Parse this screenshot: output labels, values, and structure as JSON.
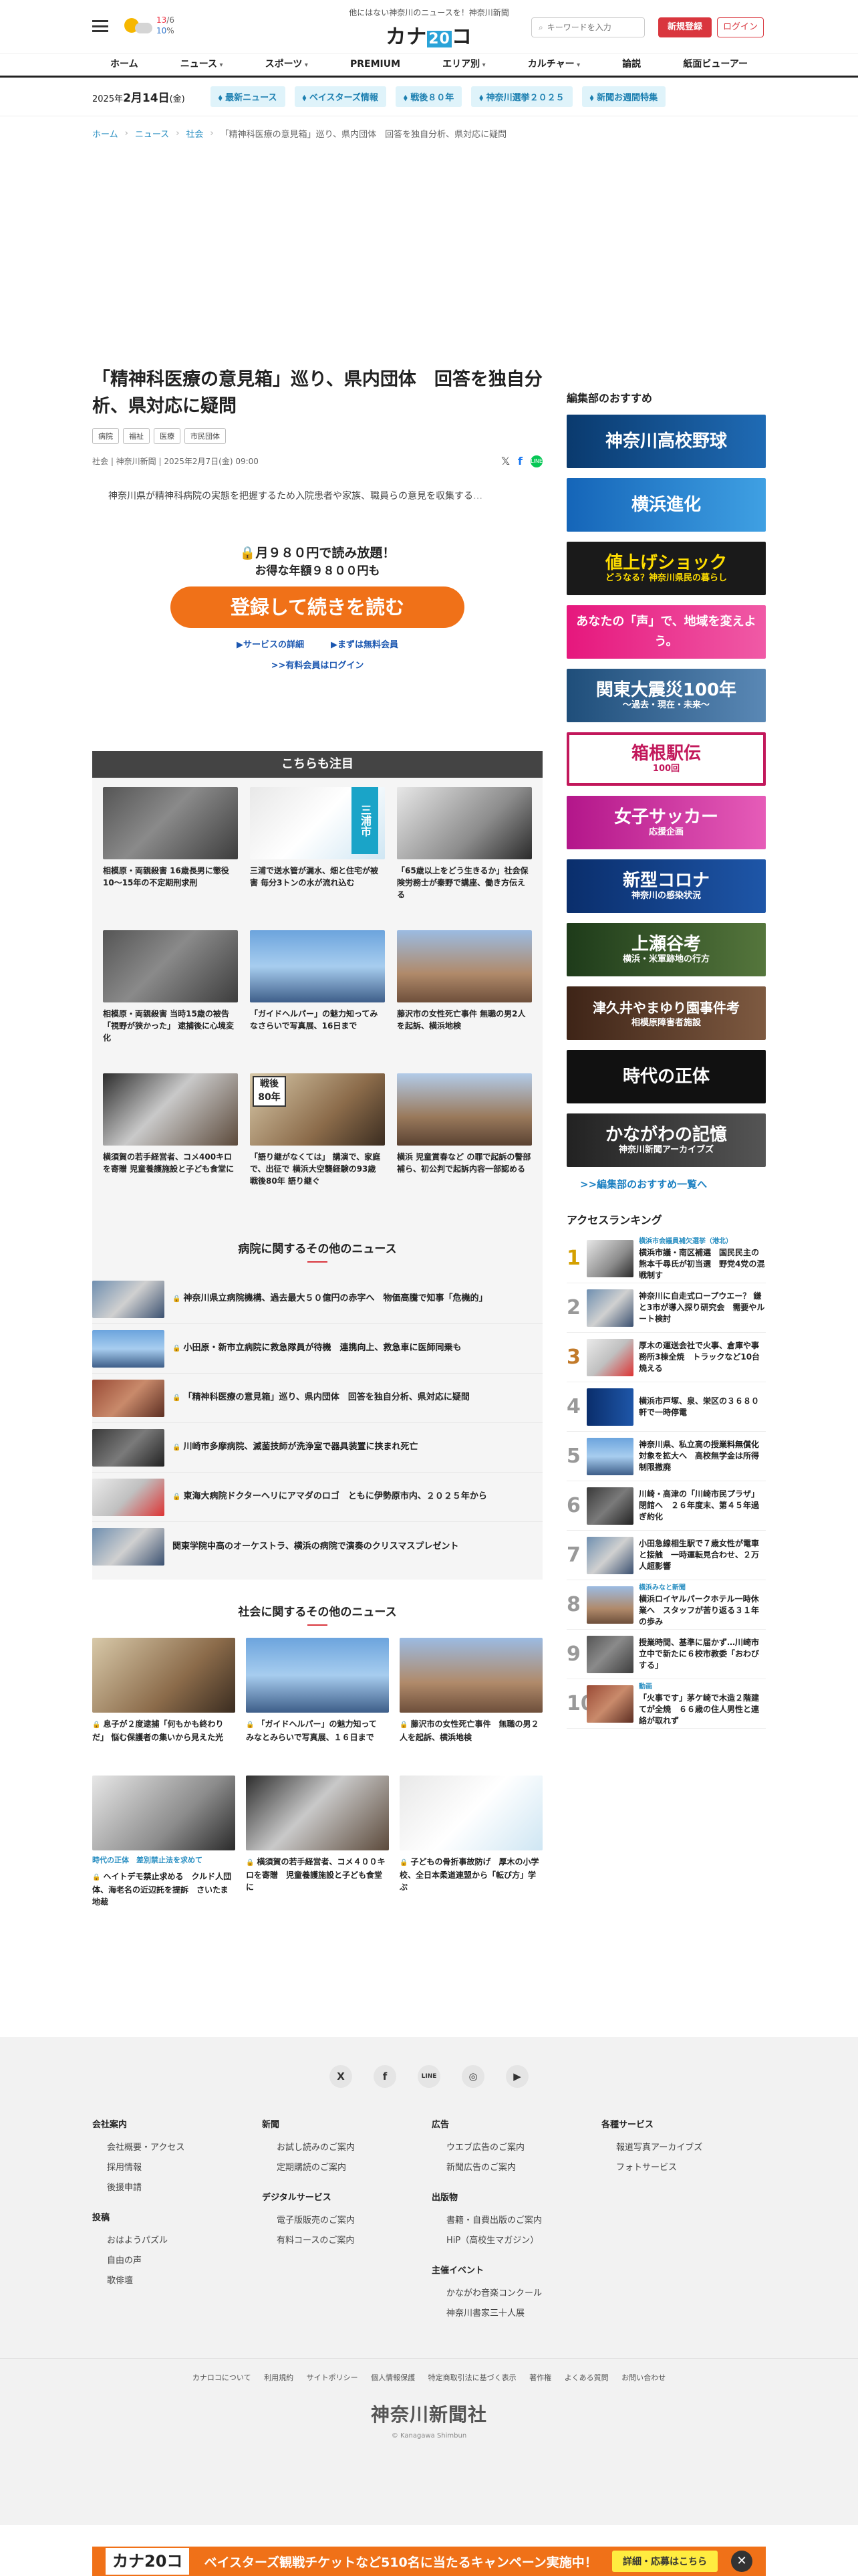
{
  "header": {
    "tagline": "他にはない神奈川のニュースを！神奈川新聞",
    "logo_pre": "カナ",
    "logo_num": "20",
    "logo_post": "コ",
    "weather_hi": "13",
    "weather_lo": "10",
    "weather_hi_unit": "/6",
    "weather_lo_unit": "%",
    "search_placeholder": "キーワードを入力",
    "register": "新規登録",
    "login": "ログイン"
  },
  "nav": [
    "ホーム",
    "ニュース",
    "スポーツ",
    "PREMIUM",
    "エリア別",
    "カルチャー",
    "論説",
    "紙面ビューアー"
  ],
  "datebar": {
    "date_pre": "2025年",
    "date_main": "2月14日",
    "date_post": "(金)",
    "chips": [
      "最新ニュース",
      "ベイスターズ情報",
      "戦後８０年",
      "神奈川選挙２０２５",
      "新聞お週間特集"
    ]
  },
  "breadcrumb": [
    "ホーム",
    "ニュース",
    "社会",
    "「精神科医療の意見箱」巡り、県内団体　回答を独自分析、県対応に疑問"
  ],
  "article": {
    "title": "「精神科医療の意見箱」巡り、県内団体　回答を独自分析、県対応に疑問",
    "tags": [
      "病院",
      "福祉",
      "医療",
      "市民団体"
    ],
    "meta": "社会 | 神奈川新聞 | 2025年2月7日(金) 09:00",
    "lede": "　神奈川県が精神科病院の実態を把握するため入院患者や家族、職員らの意見を収集する",
    "lede_fade": "…"
  },
  "paywall": {
    "line1": "🔒月９８０円で読み放題！",
    "line2": "お得な年額９８００円も",
    "cta": "登録して続きを読む",
    "link1": "▶サービスの詳細",
    "link2": "▶まずは無料会員",
    "link3": ">>有料会員はログイン"
  },
  "related": {
    "heading": "こちらも注目",
    "items": [
      {
        "title": "相模原・両親殺害 16歳長男に懲役10〜15年の不定期刑求刑",
        "label": ""
      },
      {
        "title": "三浦で送水管が漏水、畑と住宅が被害 毎分3トンの水が流れ込む",
        "label": "三浦市"
      },
      {
        "title": "「65歳以上をどう生きるか」社会保険労務士が秦野で講座、働き方伝える",
        "label": ""
      },
      {
        "title": "相模原・両親殺害 当時15歳の被告「視野が狭かった」 逮捕後に心境変化",
        "label": ""
      },
      {
        "title": "「ガイドヘルパー」の魅力知ってみなさらいで写真展、16日まで",
        "label": ""
      },
      {
        "title": "藤沢市の女性死亡事件 無職の男2人を起訴、横浜地検",
        "label": ""
      },
      {
        "title": "横須賀の若手経営者、コメ400キロを寄贈 児童養護施設と子ども食堂に",
        "label": ""
      },
      {
        "title": "「語り継がなくては」 講演で、家庭で、出征で 横浜大空襲経験の93歳 戦後80年 語り継ぐ",
        "label": "戦後80年"
      },
      {
        "title": "横浜 児童賞春など の罪で起訴の警部補ら、初公判で起訴内容一部認める",
        "label": ""
      }
    ]
  },
  "hospital": {
    "heading": "病院に関するその他のニュース",
    "items": [
      "神奈川県立病院機構、過去最大５０億円の赤字へ　物価高騰で知事「危機的」",
      "小田原・新市立病院に救急隊員が待機　連携向上、救急車に医師同乗も",
      "「精神科医療の意見箱」巡り、県内団体　回答を独自分析、県対応に疑問",
      "川崎市多摩病院、滅菌技師が洗浄室で器具装置に挟まれ死亡",
      "東海大病院ドクターヘリにアマダのロゴ　ともに伊勢原市内、２０２５年から",
      "関東学院中高のオーケストラ、横浜の病院で演奏のクリスマスプレゼント"
    ]
  },
  "society": {
    "heading": "社会に関するその他のニュース",
    "items": [
      {
        "cat": "",
        "title": "息子が２度逮捕「何もかも終わりだ」 悩む保護者の集いから見えた光"
      },
      {
        "cat": "",
        "title": "「ガイドヘルパー」の魅力知って　みなとみらいで写真展、１６日まで"
      },
      {
        "cat": "",
        "title": "藤沢市の女性死亡事件　無職の男２人を起訴、横浜地検"
      },
      {
        "cat": "時代の正体　差別禁止法を求めて",
        "title": "ヘイトデモ禁止求める　クルド人団体、海老名の近辺託を提訴　さいたま地裁"
      },
      {
        "cat": "",
        "title": "横須賀の若手経営者、コメ４００キロを寄贈　児童養護施設と子ども食堂に"
      },
      {
        "cat": "",
        "title": "子どもの骨折事故防げ　厚木の小学校、全日本柔道連盟から「転び方」学ぶ"
      }
    ]
  },
  "sidebar": {
    "heading": "編集部のおすすめ",
    "banners": [
      {
        "text": "神奈川高校野球",
        "sub": ""
      },
      {
        "text": "横浜進化",
        "sub": ""
      },
      {
        "text": "値上げショック",
        "sub": "どうなる？神奈川県民の暮らし"
      },
      {
        "text": "あなたの「声」で、地域を変えよう。",
        "sub": ""
      },
      {
        "text": "関東大震災100年",
        "sub": "〜過去・現在・未来〜"
      },
      {
        "text": "箱根駅伝",
        "sub": "100回"
      },
      {
        "text": "女子サッカー",
        "sub": "応援企画"
      },
      {
        "text": "新型コロナ",
        "sub": "神奈川の感染状況"
      },
      {
        "text": "上瀬谷考",
        "sub": "横浜・米軍跡地の行方"
      },
      {
        "text": "津久井やまゆり園事件考",
        "sub": "相模原障害者施設"
      },
      {
        "text": "時代の正体",
        "sub": ""
      },
      {
        "text": "かながわの記憶",
        "sub": "神奈川新聞アーカイブズ"
      }
    ],
    "more": ">>編集部のおすすめ一覧へ"
  },
  "ranking": {
    "heading": "アクセスランキング",
    "items": [
      {
        "num": "1",
        "label": "横浜市会議員補欠選挙（港北）",
        "title": "横浜市議・南区補選　国民民主の熊本千尋氏が初当選　野党4党の混戦制す"
      },
      {
        "num": "2",
        "label": "",
        "title": "神奈川に自走式ロープウエー？ 鎌と3市が導入探り研究会　需要やルート検討"
      },
      {
        "num": "3",
        "label": "",
        "title": "厚木の運送会社で火事、倉庫や事務所3棟全焼　トラックなど10台焼える"
      },
      {
        "num": "4",
        "label": "",
        "title": "横浜市戸塚、泉、栄区の３６８０軒で一時停電"
      },
      {
        "num": "5",
        "label": "",
        "title": "神奈川県、私立高の授業料無償化対象を拡大へ　高校無学金は所得制限撤廃"
      },
      {
        "num": "6",
        "label": "",
        "title": "川崎・高津の「川崎市民プラザ」閉館へ　２６年度末、第４５年過ぎ約化"
      },
      {
        "num": "7",
        "label": "",
        "title": "小田急線相生駅で７歳女性が電車と接触　一時運転見合わせ、２万人超影響"
      },
      {
        "num": "8",
        "label": "横浜みなと新聞",
        "title": "横浜ロイヤルパークホテル一時休業へ　スタッフが苦り返る３１年の歩み"
      },
      {
        "num": "9",
        "label": "",
        "title": "授業時間、基準に届かず…川崎市立中で新たに６校市教委「おわびする」"
      },
      {
        "num": "10",
        "label": "動画",
        "title": "「火事です」茅ケ崎で木造２階建てが全焼　６６歳の住人男性と連絡が取れず"
      }
    ]
  },
  "footer": {
    "social": [
      "X",
      "f",
      "LINE",
      "◎",
      "▶"
    ],
    "cols": [
      [
        {
          "h": "会社案内",
          "items": [
            "会社概要・アクセス",
            "採用情報",
            "後援申請"
          ]
        },
        {
          "h": "投稿",
          "items": [
            "おはようパズル",
            "自由の声",
            "歌俳壇"
          ]
        }
      ],
      [
        {
          "h": "新聞",
          "items": [
            "お試し読みのご案内",
            "定期購読のご案内"
          ]
        },
        {
          "h": "デジタルサービス",
          "items": [
            "電子版販売のご案内",
            "有料コースのご案内"
          ]
        }
      ],
      [
        {
          "h": "広告",
          "items": [
            "ウエブ広告のご案内",
            "新聞広告のご案内"
          ]
        },
        {
          "h": "出版物",
          "items": [
            "書籍・自費出版のご案内",
            "HiP（高校生マガジン）"
          ]
        },
        {
          "h": "主催イベント",
          "items": [
            "かながわ音楽コンクール",
            "神奈川書家三十人展"
          ]
        }
      ],
      [
        {
          "h": "各種サービス",
          "items": [
            "報道写真アーカイブズ",
            "フォトサービス"
          ]
        }
      ]
    ],
    "bottom_links": [
      "カナロコについて",
      "利用規約",
      "サイトポリシー",
      "個人情報保護",
      "特定商取引法に基づく表示",
      "著作権",
      "よくある質問",
      "お問い合わせ"
    ],
    "logo": "神奈川新聞社",
    "copy": "© Kanagawa Shimbun"
  },
  "sticky": {
    "logo": "カナ20コ",
    "text": "ベイスターズ観戦チケットなど510名に当たるキャンペーン実施中！",
    "button": "詳細・応募はこちら",
    "close": "✕"
  }
}
